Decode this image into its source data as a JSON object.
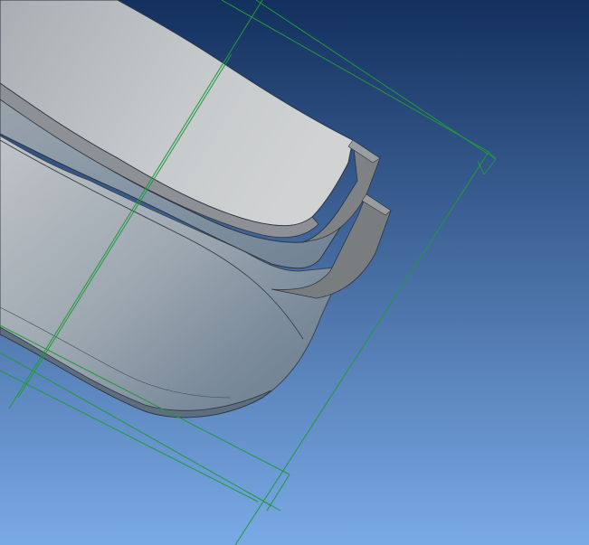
{
  "viewport": {
    "kind": "3d-cad-viewport",
    "background": {
      "top": "#13305e",
      "bottom": "#7aaae6"
    },
    "colors": {
      "model_light": "#c9cdd0",
      "model_mid": "#a9b1b8",
      "model_dark": "#6f7f8e",
      "model_edge": "#2e3640",
      "flange_face": "#8a8d90",
      "flange_dark": "#6d7073",
      "sketch_green": "#1f9a3a"
    }
  }
}
